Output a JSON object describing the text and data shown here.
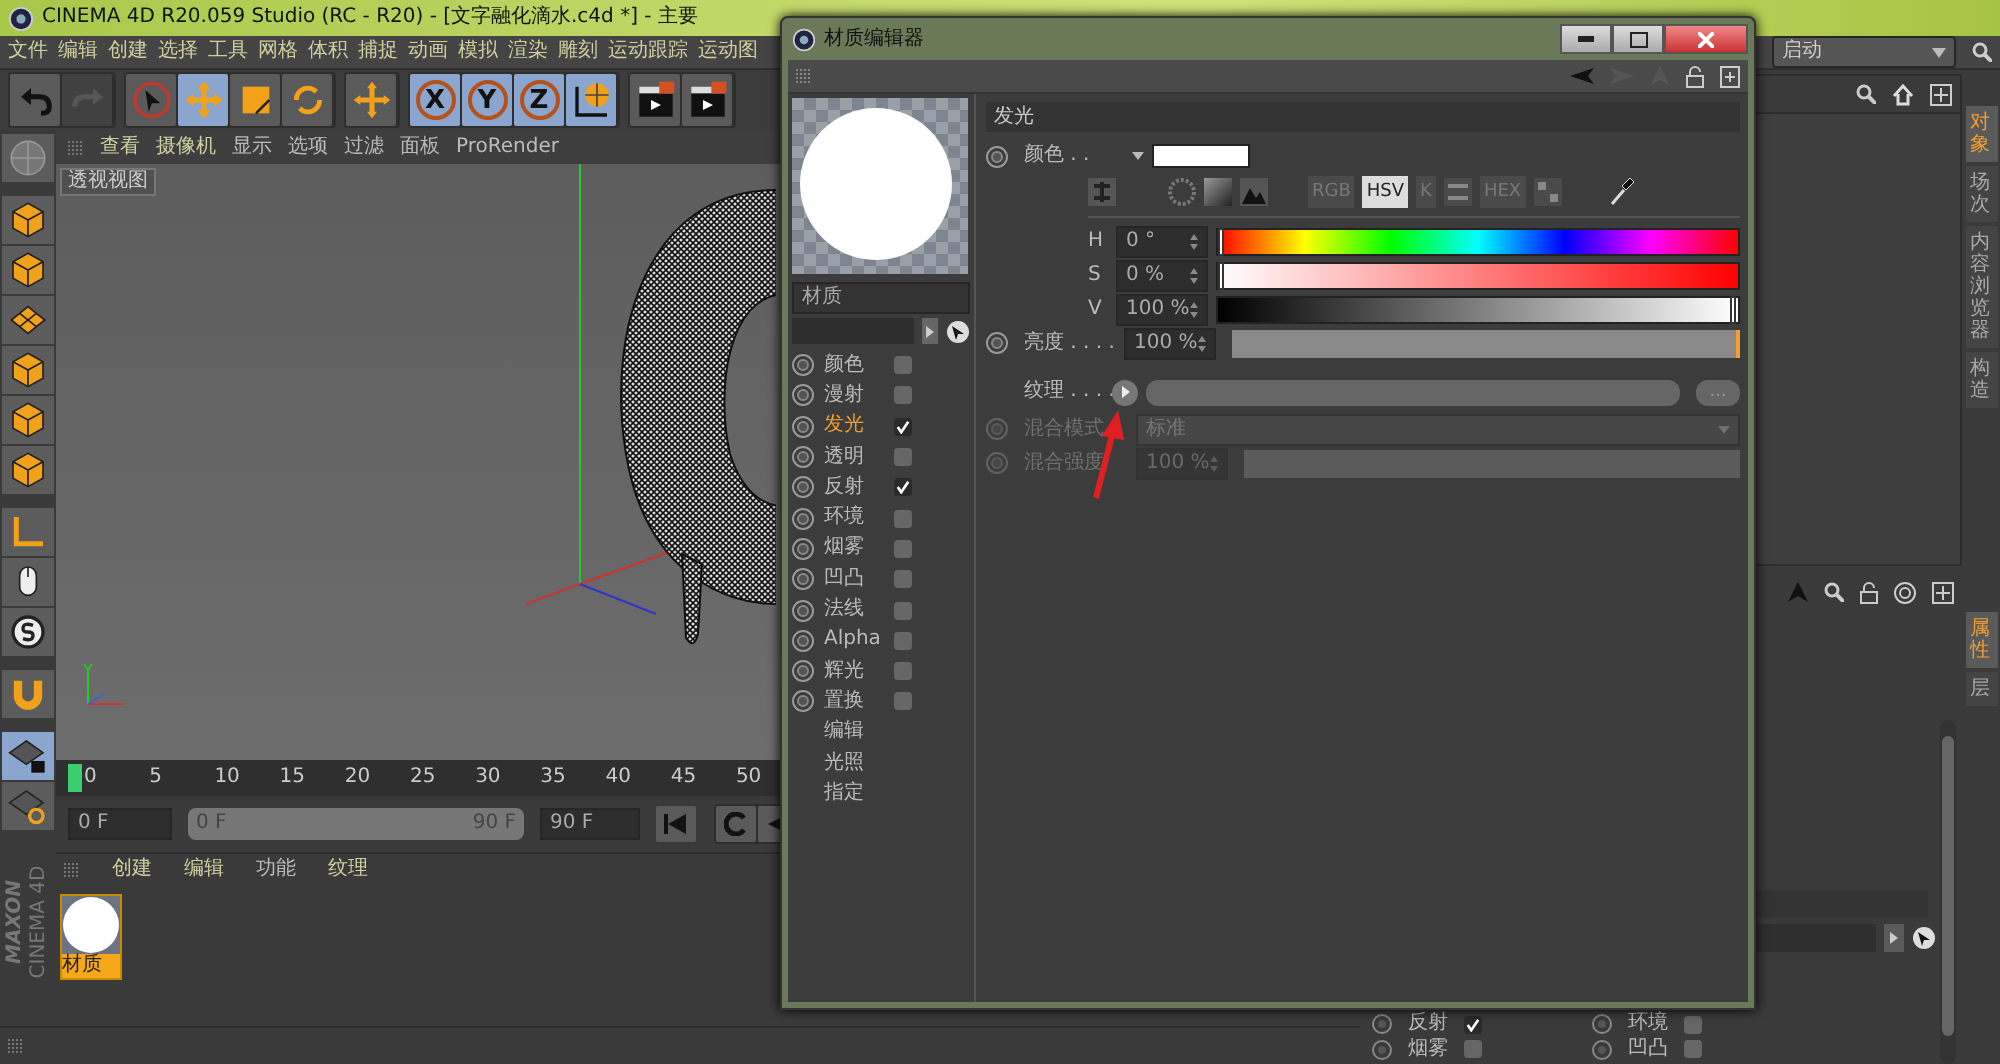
{
  "app": {
    "title": "CINEMA 4D R20.059 Studio (RC - R20) - [文字融化滴水.c4d *] - 主要"
  },
  "menu": [
    "文件",
    "编辑",
    "创建",
    "选择",
    "工具",
    "网格",
    "体积",
    "捕捉",
    "动画",
    "模拟",
    "渲染",
    "雕刻",
    "运动跟踪",
    "运动图"
  ],
  "layout_select": {
    "value": "启动"
  },
  "toolbar": [
    {
      "kind": "undo",
      "selected": false,
      "disabled": false
    },
    {
      "kind": "redo",
      "selected": false,
      "disabled": true
    },
    {
      "kind": "select",
      "selected": false,
      "disabled": false
    },
    {
      "kind": "move",
      "selected": true,
      "disabled": false
    },
    {
      "kind": "scale",
      "selected": false,
      "disabled": false
    },
    {
      "kind": "rotate",
      "selected": false,
      "disabled": false
    },
    {
      "kind": "add",
      "selected": false,
      "disabled": false
    },
    {
      "kind": "axis",
      "label": "X",
      "selected": true,
      "disabled": false
    },
    {
      "kind": "axis",
      "label": "Y",
      "selected": true,
      "disabled": false
    },
    {
      "kind": "axis",
      "label": "Z",
      "selected": true,
      "disabled": false
    },
    {
      "kind": "world",
      "selected": true,
      "disabled": false
    },
    {
      "kind": "render",
      "selected": false,
      "disabled": false
    },
    {
      "kind": "render",
      "selected": false,
      "disabled": false
    }
  ],
  "left_tools": [
    {
      "kind": "sphere",
      "selected": false
    },
    {
      "kind": "cube",
      "selected": false
    },
    {
      "kind": "cube",
      "selected": false
    },
    {
      "kind": "grid",
      "selected": false
    },
    {
      "kind": "cube",
      "selected": false
    },
    {
      "kind": "cube",
      "selected": false
    },
    {
      "kind": "cube",
      "selected": false
    },
    {
      "kind": "axis",
      "selected": false
    },
    {
      "kind": "tweak",
      "selected": false
    },
    {
      "kind": "snap",
      "selected": false
    },
    {
      "kind": "magnet",
      "selected": false
    },
    {
      "kind": "lock",
      "selected": true
    },
    {
      "kind": "loop",
      "selected": false
    }
  ],
  "viewport": {
    "menu": [
      "查看",
      "摄像机",
      "显示",
      "选项",
      "过滤",
      "面板",
      "ProRender"
    ],
    "label": "透视视图"
  },
  "timeline": {
    "ticks": [
      "0",
      "5",
      "10",
      "15",
      "20",
      "25",
      "30",
      "35",
      "40",
      "45",
      "50"
    ],
    "start": "0 F",
    "range": {
      "start": "0 F",
      "end": "90 F",
      "level": 1
    },
    "end": "90 F"
  },
  "material_manager": {
    "menu": [
      "创建",
      "编辑",
      "功能",
      "纹理"
    ],
    "materials": [
      {
        "name": "材质",
        "selected": true
      }
    ]
  },
  "brand": {
    "line1": "MAXON",
    "line2": "CINEMA 4D"
  },
  "object_tabs": [
    {
      "label": "对象",
      "selected": true
    },
    {
      "label": "场次",
      "selected": false
    },
    {
      "label": "内容浏览器",
      "selected": false
    },
    {
      "label": "构造",
      "selected": false
    }
  ],
  "attribute_tabs": [
    {
      "label": "属性",
      "selected": true
    },
    {
      "label": "层",
      "selected": false
    }
  ],
  "attribute_rows": [
    {
      "label": "反射",
      "checked": true
    },
    {
      "label": "环境",
      "checked": false
    },
    {
      "label": "烟雾",
      "checked": false
    },
    {
      "label": "凹凸",
      "checked": false
    }
  ],
  "material_editor": {
    "title": "材质编辑器",
    "name": "材质",
    "channels": [
      {
        "kind": "channel",
        "label": "颜色",
        "checked": false,
        "selected": false
      },
      {
        "kind": "channel",
        "label": "漫射",
        "checked": false,
        "selected": false
      },
      {
        "kind": "channel",
        "label": "发光",
        "checked": true,
        "selected": true
      },
      {
        "kind": "channel",
        "label": "透明",
        "checked": false,
        "selected": false
      },
      {
        "kind": "channel",
        "label": "反射",
        "checked": true,
        "selected": false
      },
      {
        "kind": "channel",
        "label": "环境",
        "checked": false,
        "selected": false
      },
      {
        "kind": "channel",
        "label": "烟雾",
        "checked": false,
        "selected": false
      },
      {
        "kind": "channel",
        "label": "凹凸",
        "checked": false,
        "selected": false
      },
      {
        "kind": "channel",
        "label": "法线",
        "checked": false,
        "selected": false
      },
      {
        "kind": "channel",
        "label": "Alpha",
        "checked": false,
        "selected": false
      },
      {
        "kind": "channel",
        "label": "辉光",
        "checked": false,
        "selected": false
      },
      {
        "kind": "channel",
        "label": "置换",
        "checked": false,
        "selected": false
      },
      {
        "kind": "page",
        "label": "编辑",
        "selected": false
      },
      {
        "kind": "page",
        "label": "光照",
        "selected": false
      },
      {
        "kind": "page",
        "label": "指定",
        "selected": false
      }
    ],
    "section_title": "发光",
    "color": {
      "label": "颜色 . .",
      "color": "#ffffff"
    },
    "color_modes": [
      {
        "label": "RGB",
        "selected": false
      },
      {
        "label": "HSV",
        "selected": true
      },
      {
        "label": "K",
        "selected": false
      },
      {
        "label": "HEX",
        "selected": false
      }
    ],
    "sliders": [
      {
        "kind": "hue",
        "label": "H",
        "value": "0 °",
        "level": 0
      },
      {
        "kind": "saturation",
        "label": "S",
        "value": "0 %",
        "level": 0
      },
      {
        "kind": "value",
        "label": "V",
        "value": "100 %",
        "level": 1
      }
    ],
    "brightness": {
      "label": "亮度 . . . .",
      "value": "100 %",
      "level": 1
    },
    "texture": {
      "label": "纹理 . . . .",
      "more": "..."
    },
    "blend_mode": {
      "label": "混合模式",
      "value": "标准",
      "disabled": true
    },
    "blend_strength": {
      "label": "混合强度",
      "value": "100 %",
      "level": 1,
      "disabled": true
    }
  }
}
